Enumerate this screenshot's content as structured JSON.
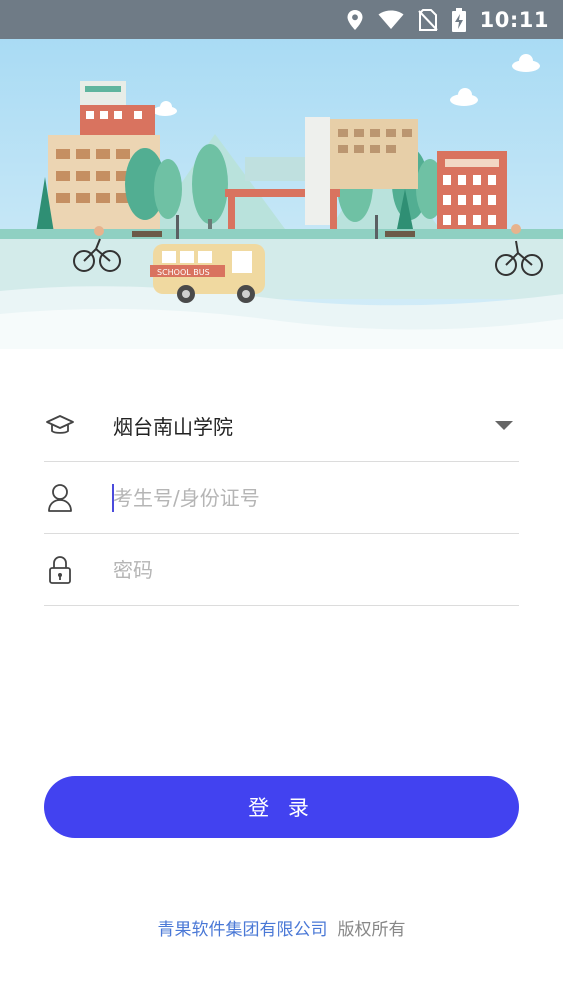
{
  "status_bar": {
    "time": "10:11",
    "icons": [
      "location-icon",
      "wifi-icon",
      "no-sim-icon",
      "battery-charging-icon"
    ]
  },
  "banner": {
    "bus_label": "SCHOOL BUS"
  },
  "form": {
    "school": {
      "icon": "graduation-cap-icon",
      "selected": "烟台南山学院"
    },
    "username": {
      "icon": "user-icon",
      "placeholder": "考生号/身份证号",
      "value": ""
    },
    "password": {
      "icon": "lock-icon",
      "placeholder": "密码",
      "value": ""
    }
  },
  "login_button": {
    "label": "登 录"
  },
  "footer": {
    "company": "青果软件集团有限公司",
    "rights": "版权所有"
  },
  "colors": {
    "accent": "#4242f0",
    "status_bar": "#6f7b86",
    "footer_link": "#4a78d6"
  }
}
